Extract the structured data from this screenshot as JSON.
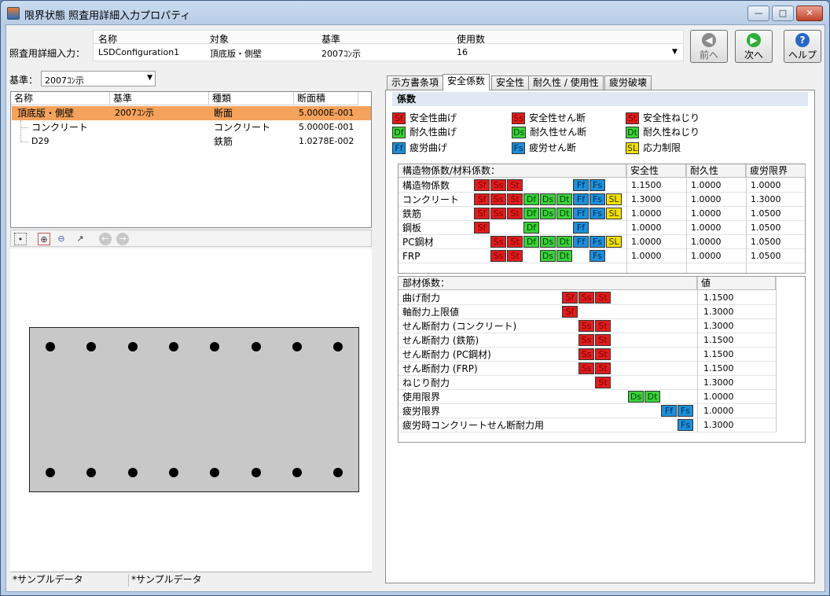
{
  "window": {
    "title": "限界状態 照査用詳細入力プロパティ",
    "min": "—",
    "max": "□",
    "close": "✕"
  },
  "header": {
    "row_label": "照査用詳細入力：",
    "columns": [
      "名称",
      "対象",
      "基準",
      "使用数"
    ],
    "values": [
      "LSDConfiguration1",
      "頂底版・側壁",
      "2007ｺﾝ示",
      "16"
    ]
  },
  "nav": {
    "prev": "前へ",
    "next": "次へ",
    "help": "ヘルプ"
  },
  "left": {
    "kijun_label": "基準：",
    "kijun_value": "2007ｺﾝ示",
    "tree_headers": [
      "名称",
      "基準",
      "種類",
      "断面積"
    ],
    "rows": [
      {
        "name": "頂底版・側壁",
        "kijun": "2007ｺﾝ示",
        "type": "断面",
        "area": "5.0000E-001"
      },
      {
        "name": "コンクリート",
        "kijun": "",
        "type": "コンクリート",
        "area": "5.0000E-001"
      },
      {
        "name": "D29",
        "kijun": "",
        "type": "鉄筋",
        "area": "1.0278E-002"
      }
    ],
    "status": [
      "*サンプルデータ",
      "*サンプルデータ"
    ]
  },
  "tabs": [
    "示方書条項",
    "安全係数",
    "安全性",
    "耐久性 / 使用性",
    "疲労破壊"
  ],
  "active_tab": "安全係数",
  "section_title": "係数",
  "legend": [
    {
      "code": "Sf",
      "color": "red",
      "label": "安全性曲げ"
    },
    {
      "code": "Ss",
      "color": "red",
      "label": "安全性せん断"
    },
    {
      "code": "St",
      "color": "red",
      "label": "安全性ねじり"
    },
    {
      "code": "Df",
      "color": "grn",
      "label": "耐久性曲げ"
    },
    {
      "code": "Ds",
      "color": "grn",
      "label": "耐久性せん断"
    },
    {
      "code": "Dt",
      "color": "grn",
      "label": "耐久性ねじり"
    },
    {
      "code": "Ff",
      "color": "blu",
      "label": "疲労曲げ"
    },
    {
      "code": "Fs",
      "color": "blu",
      "label": "疲労せん断"
    },
    {
      "code": "SL",
      "color": "yel",
      "label": "応力制限"
    }
  ],
  "material_table": {
    "headers": [
      "構造物係数/材料係数：",
      "安全性",
      "耐久性",
      "疲労限界"
    ],
    "rows": [
      {
        "label": "構造物係数",
        "chips": [
          "Sf",
          "Ss",
          "St",
          "",
          "",
          "",
          "Ff",
          "Fs",
          ""
        ],
        "v": [
          "1.1500",
          "1.0000",
          "1.0000"
        ]
      },
      {
        "label": "コンクリート",
        "chips": [
          "Sf",
          "Ss",
          "St",
          "Df",
          "Ds",
          "Dt",
          "Ff",
          "Fs",
          "SL"
        ],
        "v": [
          "1.3000",
          "1.0000",
          "1.3000"
        ]
      },
      {
        "label": "鉄筋",
        "chips": [
          "Sf",
          "Ss",
          "St",
          "Df",
          "Ds",
          "Dt",
          "Ff",
          "Fs",
          "SL"
        ],
        "v": [
          "1.0000",
          "1.0000",
          "1.0500"
        ]
      },
      {
        "label": "鋼板",
        "chips": [
          "Sf",
          "",
          "",
          "Df",
          "",
          "",
          "Ff",
          "",
          ""
        ],
        "v": [
          "1.0000",
          "1.0000",
          "1.0500"
        ]
      },
      {
        "label": "PC鋼材",
        "chips": [
          "",
          "Ss",
          "St",
          "Df",
          "Ds",
          "Dt",
          "Ff",
          "Fs",
          "SL"
        ],
        "v": [
          "1.0000",
          "1.0000",
          "1.0500"
        ]
      },
      {
        "label": "FRP",
        "chips": [
          "",
          "Ss",
          "St",
          "",
          "Ds",
          "Dt",
          "",
          "Fs",
          ""
        ],
        "v": [
          "1.0000",
          "1.0000",
          "1.0500"
        ]
      }
    ]
  },
  "member_table": {
    "headers": [
      "部材係数：",
      "値"
    ],
    "rows": [
      {
        "label": "曲げ耐力",
        "chips": [
          "Sf",
          "Ss",
          "St"
        ],
        "start": 0,
        "v": "1.1500"
      },
      {
        "label": "軸耐力上限値",
        "chips": [
          "Sf"
        ],
        "start": 0,
        "v": "1.3000"
      },
      {
        "label": "せん断耐力 (コンクリート)",
        "chips": [
          "Ss",
          "St"
        ],
        "start": 1,
        "v": "1.3000"
      },
      {
        "label": "せん断耐力 (鉄筋)",
        "chips": [
          "Ss",
          "St"
        ],
        "start": 1,
        "v": "1.1500"
      },
      {
        "label": "せん断耐力 (PC鋼材)",
        "chips": [
          "Ss",
          "St"
        ],
        "start": 1,
        "v": "1.1500"
      },
      {
        "label": "せん断耐力 (FRP)",
        "chips": [
          "Ss",
          "St"
        ],
        "start": 1,
        "v": "1.1500"
      },
      {
        "label": "ねじり耐力",
        "chips": [
          "St"
        ],
        "start": 2,
        "v": "1.3000"
      },
      {
        "label": "使用限界",
        "chips": [
          "Ds",
          "Dt"
        ],
        "start": 4,
        "v": "1.0000"
      },
      {
        "label": "疲労限界",
        "chips": [
          "Ff",
          "Fs"
        ],
        "start": 6,
        "v": "1.0000"
      },
      {
        "label": "疲労時コンクリートせん断耐力用",
        "chips": [
          "Fs"
        ],
        "start": 7,
        "v": "1.3000"
      }
    ]
  },
  "colors": {
    "red": "#e01d1d",
    "grn": "#3bd13b",
    "blu": "#1e8fd8",
    "yel": "#f2e200",
    "selected_row": "#f5a25c"
  },
  "icons": [
    "fit-icon",
    "zoom-rect-icon",
    "zoom-out-icon",
    "arrow-icon",
    "back-icon",
    "forward-icon"
  ]
}
